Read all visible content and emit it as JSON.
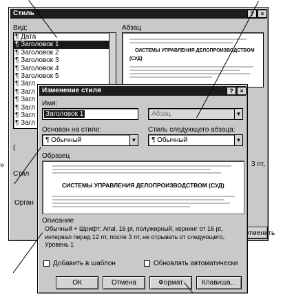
{
  "style_dialog": {
    "title": "Стиль",
    "list_label": "Вид:",
    "items": [
      "Дата",
      "Заголовок 1",
      "Заголовок 2",
      "Заголовок 3",
      "Заголовок 4",
      "Заголовок 5",
      "Загл",
      "Загл",
      "Загл",
      "Загл",
      "Загл",
      "Загл"
    ],
    "selected_index": 1,
    "preview_label": "Абзац",
    "preview_heading": "СИСТЕМЫ УПРАВЛЕНИЯ ДЕЛОПРОИЗВОДСТВОМ",
    "preview_sub": "(СУД)",
    "side_text_1": "(",
    "side_text_2": "Стил",
    "bottom_text_1": "Орган",
    "right_text": "3 пт,",
    "right_button": "отменить"
  },
  "modify_dialog": {
    "title": "Изменение стиля",
    "name_label": "Имя:",
    "name_value": "Заголовок 1",
    "type_value": "Абзац",
    "based_label": "Основан на стиле:",
    "based_value": "¶ Обычный",
    "next_label": "Стиль следующего абзаца:",
    "next_value": "¶ Обычный",
    "sample_label": "Образец",
    "sample_heading": "СИСТЕМЫ УПРАВЛЕНИЯ ДЕЛОПРОИЗВОДСТВОМ (СУД)",
    "description_label": "Описание",
    "description_line1": "Обычный + Шрифт: Arial, 16 pt, полужирный, кернинг от 16 pt,",
    "description_line2": "интервал перед 12 пт, после 3 пт, не отрывать от следующего,",
    "description_line3": "Уровень 1",
    "add_to_template": "Добавить в шаблон",
    "auto_update": "Обновлять автоматически",
    "ok_button": "ОК",
    "cancel_button": "Отмена",
    "format_button": "Формат",
    "shortcut_button": "Клавиша...",
    "help_glyph": "?",
    "close_glyph": "×"
  },
  "left_marker": "»"
}
